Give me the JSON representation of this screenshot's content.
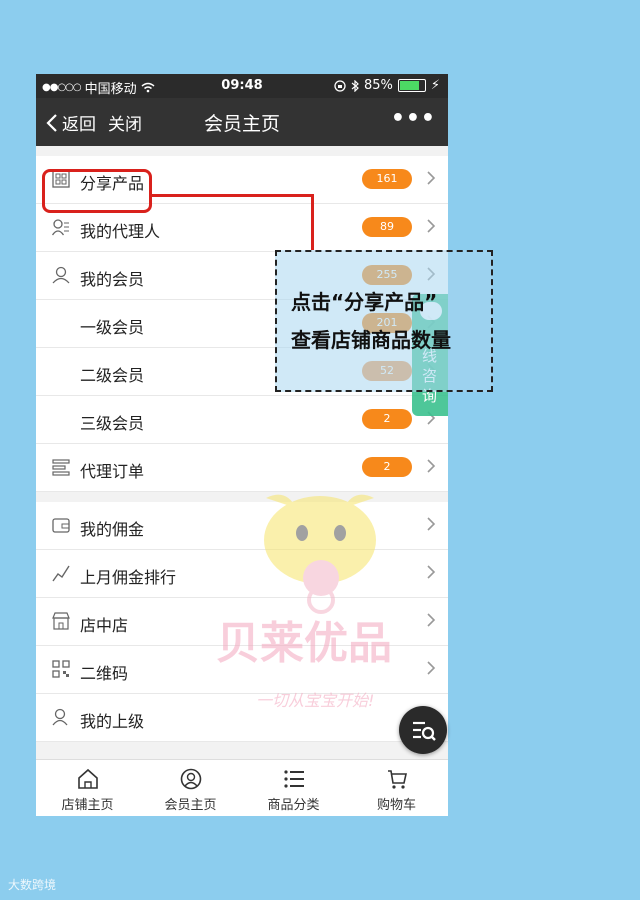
{
  "status_bar": {
    "carrier": "中国移动",
    "time": "09:48",
    "battery": "85%",
    "battery_level": 0.85
  },
  "nav": {
    "back_label": "返回",
    "close_label": "关闭",
    "title": "会员主页",
    "more_label": "•••"
  },
  "menu": {
    "share_products": {
      "label": "分享产品",
      "count": "161"
    },
    "my_agents": {
      "label": "我的代理人",
      "count": "89"
    },
    "my_members": {
      "label": "我的会员",
      "count": "255"
    },
    "level1": {
      "label": "一级会员",
      "count": "201"
    },
    "level2": {
      "label": "二级会员",
      "count": "52"
    },
    "level3": {
      "label": "三级会员",
      "count": "2"
    },
    "agent_orders": {
      "label": "代理订单",
      "count": "2"
    },
    "my_commission": {
      "label": "我的佣金"
    },
    "ranking": {
      "label": "上月佣金排行"
    },
    "shop_in_shop": {
      "label": "店中店"
    },
    "qr_code": {
      "label": "二维码"
    },
    "my_superior": {
      "label": "我的上级"
    }
  },
  "tabbar": {
    "shop_home": "店铺主页",
    "member_home": "会员主页",
    "categories": "商品分类",
    "cart": "购物车"
  },
  "annotation": {
    "line1": "点击“分享产品”",
    "line2": "查看店铺商品数量"
  },
  "consult": {
    "text": "线咨询"
  },
  "watermark": {
    "brand": "贝莱优品",
    "slogan": "一切从宝宝开始!"
  },
  "corner_mark": "大数跨境",
  "colors": {
    "page_bg": "#8ccdee",
    "nav_bg": "#333333",
    "badge": "#f7891b",
    "highlight": "#d9211c",
    "consult": "#3bc18f"
  },
  "icons": [
    "back-chevron-icon",
    "more-dots-icon",
    "grid-icon",
    "agent-icon",
    "user-icon",
    "order-list-icon",
    "wallet-icon",
    "trend-icon",
    "shop-icon",
    "qr-icon",
    "superior-icon",
    "chevron-right-icon",
    "home-icon",
    "member-icon",
    "category-icon",
    "cart-icon",
    "search-list-icon",
    "chat-icon"
  ]
}
